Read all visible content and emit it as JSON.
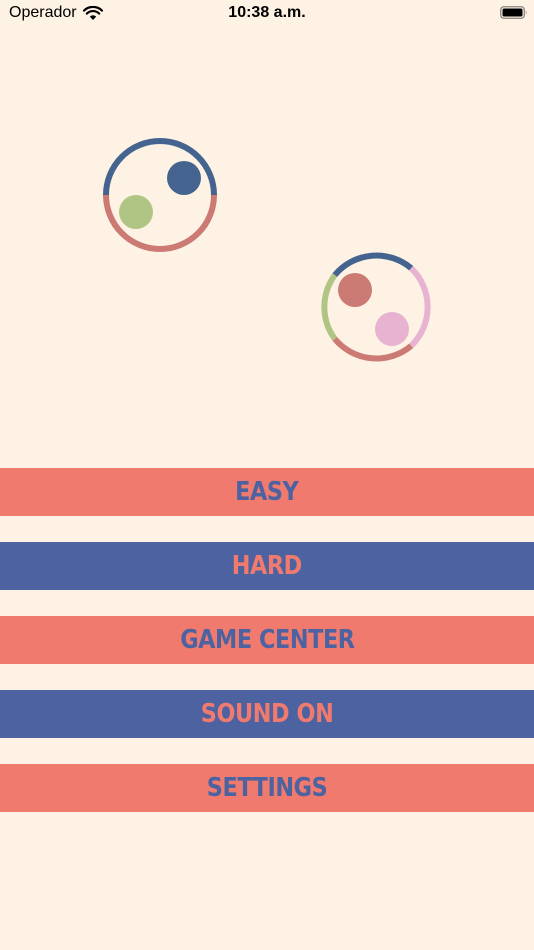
{
  "status_bar": {
    "carrier": "Operador",
    "time": "10:38 a.m.",
    "icons": [
      "wifi-icon",
      "battery-icon"
    ]
  },
  "menu": {
    "items": [
      {
        "label": "EASY"
      },
      {
        "label": "HARD"
      },
      {
        "label": "GAME CENTER"
      },
      {
        "label": "SOUND ON"
      },
      {
        "label": "SETTINGS"
      }
    ]
  },
  "colors": {
    "background": "#fdf2e4",
    "coral": "#f07a6d",
    "blue": "#4d63a1",
    "ring_blue": "#44648f",
    "ring_red": "#cc7a74",
    "ring_green": "#b0c584",
    "ring_pink": "#e7b3d1"
  },
  "decorations": [
    "ring-with-two-balls-icon",
    "ring-with-three-segments-icon"
  ]
}
